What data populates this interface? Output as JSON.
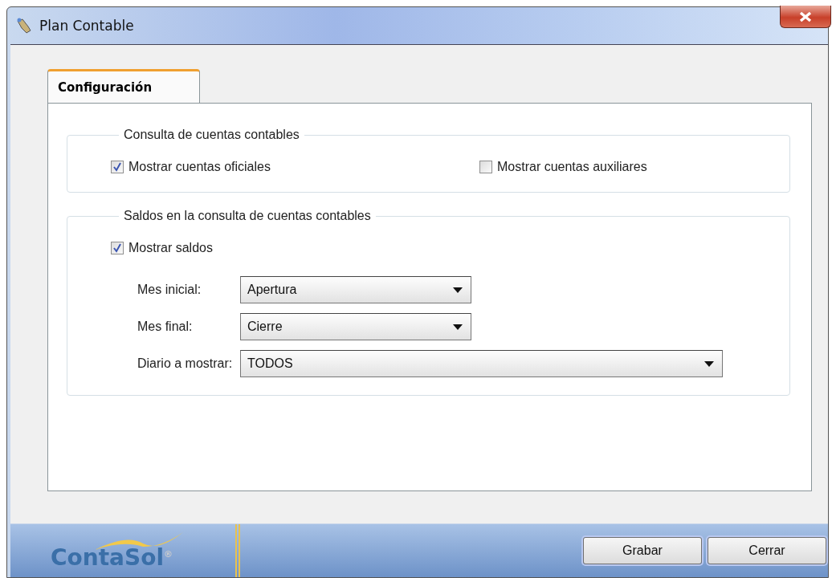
{
  "window": {
    "title": "Plan Contable"
  },
  "tabs": [
    {
      "label": "Configuración",
      "selected": true
    }
  ],
  "groups": [
    {
      "title": "Consulta de cuentas contables",
      "checkboxes": [
        {
          "label": "Mostrar cuentas oficiales",
          "checked": true
        },
        {
          "label": "Mostrar cuentas auxiliares",
          "checked": false
        }
      ]
    },
    {
      "title": "Saldos en la consulta de cuentas contables",
      "checkboxes": [
        {
          "label": "Mostrar saldos",
          "checked": true
        }
      ],
      "fields": [
        {
          "label": "Mes inicial:",
          "value": "Apertura"
        },
        {
          "label": "Mes final:",
          "value": "Cierre"
        },
        {
          "label": "Diario a mostrar:",
          "value": "TODOS"
        }
      ]
    }
  ],
  "footer": {
    "logo": "ContaSol$^{®}$",
    "buttons": [
      "Grabar",
      "Cerrar"
    ]
  }
}
